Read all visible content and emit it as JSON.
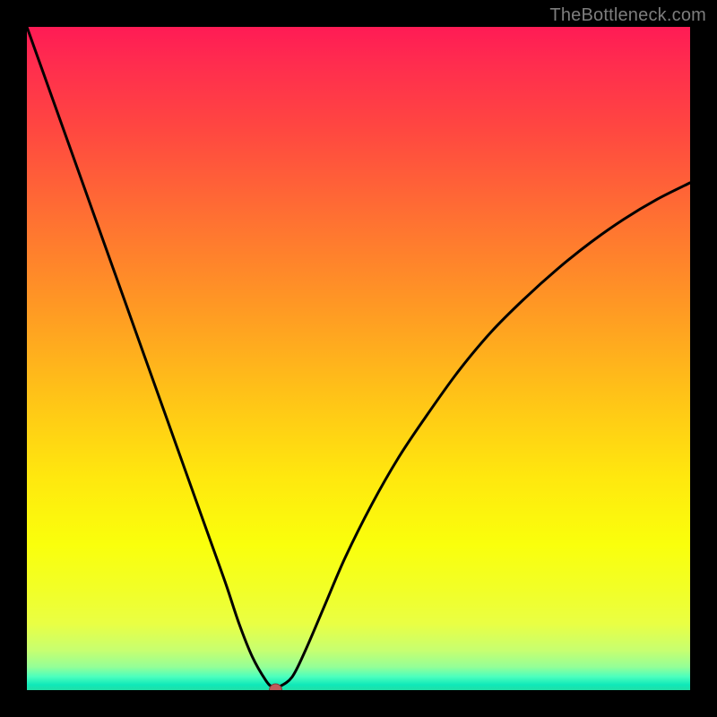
{
  "watermark": "TheBottleneck.com",
  "chart_data": {
    "type": "line",
    "title": "",
    "xlabel": "",
    "ylabel": "",
    "xlim": [
      0,
      100
    ],
    "ylim": [
      0,
      100
    ],
    "grid": false,
    "legend": false,
    "background_gradient": {
      "top": "#FF1B55",
      "bottom": "#22E0A6",
      "meaning": "red (top) = high bottleneck, green (bottom) = low bottleneck"
    },
    "series": [
      {
        "name": "bottleneck-curve",
        "color": "#000000",
        "x": [
          0.0,
          2.5,
          5.0,
          7.5,
          10.0,
          12.5,
          15.0,
          17.5,
          20.0,
          22.5,
          25.0,
          27.5,
          30.0,
          32.0,
          34.0,
          36.0,
          37.0,
          38.0,
          40.0,
          42.0,
          45.0,
          48.0,
          52.0,
          56.0,
          60.0,
          65.0,
          70.0,
          75.0,
          80.0,
          85.0,
          90.0,
          95.0,
          100.0
        ],
        "y": [
          100.0,
          93.0,
          86.0,
          79.0,
          72.0,
          65.0,
          58.0,
          51.0,
          44.0,
          37.0,
          30.0,
          23.0,
          16.0,
          10.0,
          5.0,
          1.5,
          0.5,
          0.5,
          2.0,
          6.0,
          13.0,
          20.0,
          28.0,
          35.0,
          41.0,
          48.0,
          54.0,
          59.0,
          63.5,
          67.5,
          71.0,
          74.0,
          76.5
        ]
      }
    ],
    "marker": {
      "name": "optimal-point",
      "x": 37.5,
      "y": 0,
      "color": "#C25A5A",
      "radius": 7
    }
  }
}
